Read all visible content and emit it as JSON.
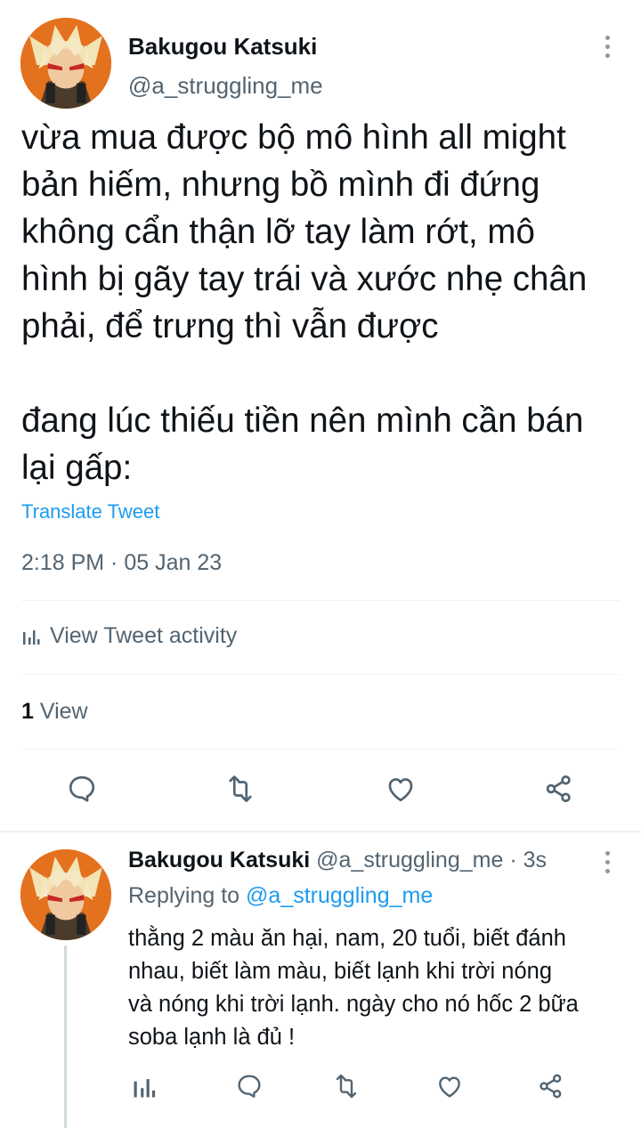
{
  "tweet": {
    "author_name": "Bakugou Katsuki",
    "author_handle": "@a_struggling_me",
    "text": "vừa mua được bộ mô hình all might\nbản hiếm, nhưng bồ mình đi đứng\nkhông cẩn thận lỡ tay làm rớt, mô\nhình bị gãy tay trái và xước nhẹ chân\nphải, để trưng thì vẫn được\n\nđang lúc thiếu tiền nên mình cần bán\nlại gấp:",
    "translate_label": "Translate Tweet",
    "timestamp": "2:18 PM · 05 Jan 23",
    "activity_label": "View Tweet activity",
    "views_count": "1",
    "views_label": " View"
  },
  "actions": {
    "icons": [
      "reply-icon",
      "retweet-icon",
      "like-icon",
      "share-icon"
    ]
  },
  "reply": {
    "author_name": "Bakugou Katsuki",
    "author_handle": "@a_struggling_me",
    "time": "3s",
    "separator": " · ",
    "replying_to_label": "Replying to ",
    "replying_to_handle": "@a_struggling_me",
    "text": "thằng 2 màu ăn hại, nam, 20 tuổi, biết đánh\nnhau, biết làm màu, biết lạnh khi trời nóng\nvà nóng khi trời lạnh. ngày cho nó hốc 2 bữa\nsoba lạnh là đủ !",
    "action_icons": [
      "analytics-icon",
      "reply-icon",
      "retweet-icon",
      "like-icon",
      "share-icon"
    ]
  },
  "colors": {
    "text": "#0f1419",
    "secondary": "#536471",
    "link": "#1d9bf0",
    "divider": "#eff3f4",
    "avatar_bg": "#e4711e"
  }
}
